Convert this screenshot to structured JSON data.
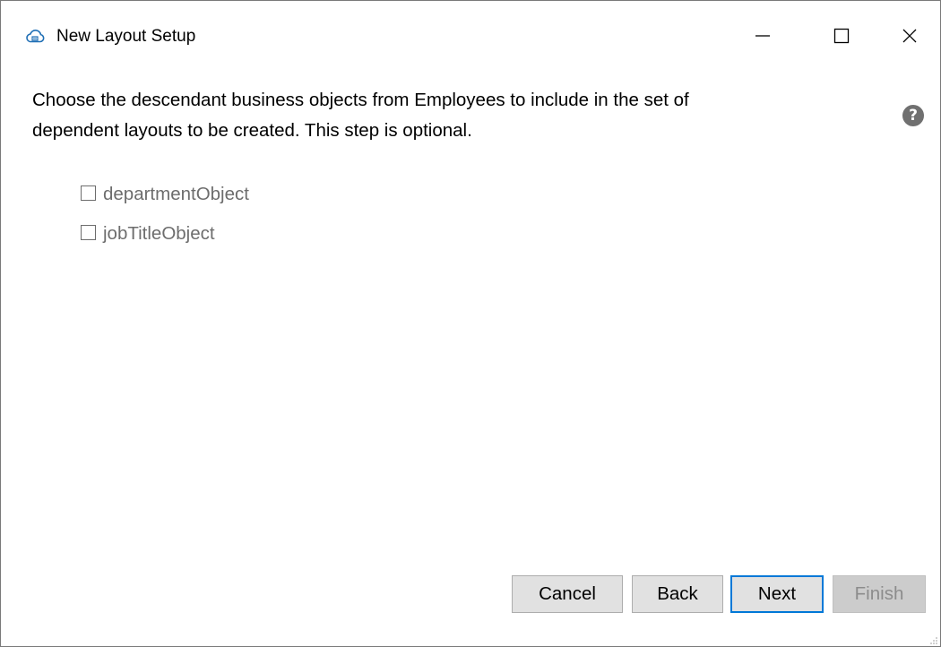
{
  "window": {
    "title": "New Layout Setup",
    "icon": "cloud-icon",
    "controls": {
      "minimize": "minimize-icon",
      "maximize": "maximize-icon",
      "close": "close-icon"
    }
  },
  "content": {
    "instruction_line1": "Choose the descendant business objects from Employees to include in the set of",
    "instruction_line2": "dependent layouts to be created. This step is optional.",
    "help_glyph": "?",
    "objects": [
      {
        "label": "departmentObject",
        "checked": false
      },
      {
        "label": "jobTitleObject",
        "checked": false
      }
    ]
  },
  "buttons": {
    "cancel": "Cancel",
    "back": "Back",
    "next": "Next",
    "finish": "Finish",
    "finish_enabled": false,
    "default_button": "next"
  },
  "colors": {
    "accent": "#0078d7",
    "button_face": "#e1e1e1",
    "disabled_text": "#8c8c8c",
    "help_icon": "#707070",
    "checkbox_label": "#6d6d6d"
  }
}
